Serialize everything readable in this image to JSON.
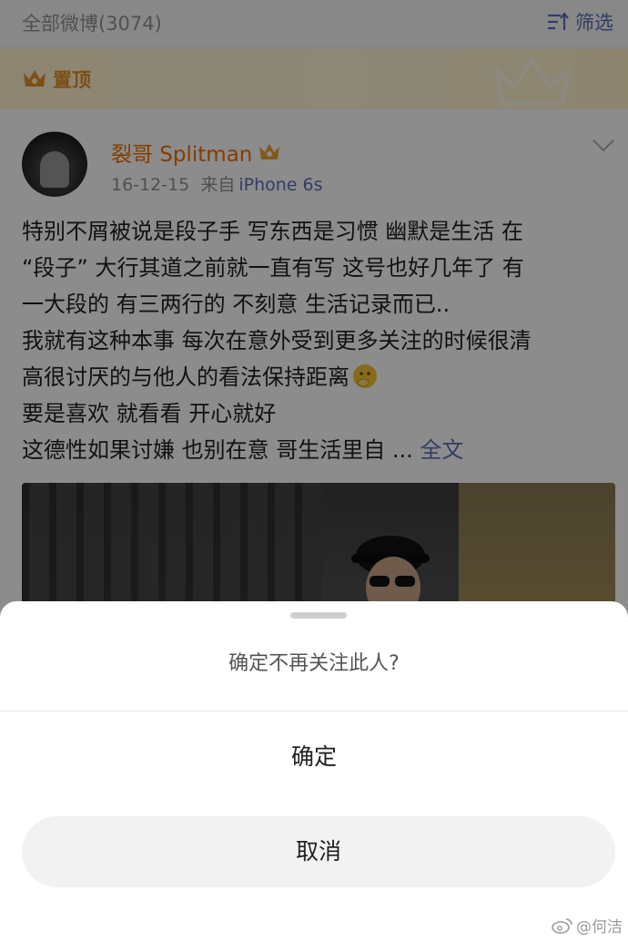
{
  "filter_bar": {
    "title": "全部微博(3074)",
    "filter_label": "筛选"
  },
  "pinned": {
    "label": "置顶"
  },
  "post": {
    "author": "裂哥 Splitman",
    "date": "16-12-15",
    "source_prefix": "来自",
    "device": "iPhone 6s",
    "lines": [
      "特别不屑被说是段子手 写东西是习惯 幽默是生活 在",
      "“段子” 大行其道之前就一直有写 这号也好几年了 有",
      "一大段的 有三两行的 不刻意 生活记录而已..",
      "我就有这种本事 每次在意外受到更多关注的时候很清",
      "高很讨厌的与他人的看法保持距离",
      "要是喜欢 就看看 开心就好",
      "这德性如果讨嫌 也别在意 哥生活里自 ..."
    ],
    "full_text_link": "全文"
  },
  "sheet": {
    "prompt": "确定不再关注此人?",
    "confirm_label": "确定",
    "cancel_label": "取消"
  },
  "watermark": {
    "text": "@何洁"
  },
  "colors": {
    "link": "#5b6fb8",
    "author": "#f07000",
    "pinned": "#e0902a"
  },
  "icons": [
    "filter-icon",
    "crown-icon",
    "vip-crown-icon",
    "chevron-down-icon",
    "thinking-emoji-icon",
    "weibo-logo-icon"
  ]
}
